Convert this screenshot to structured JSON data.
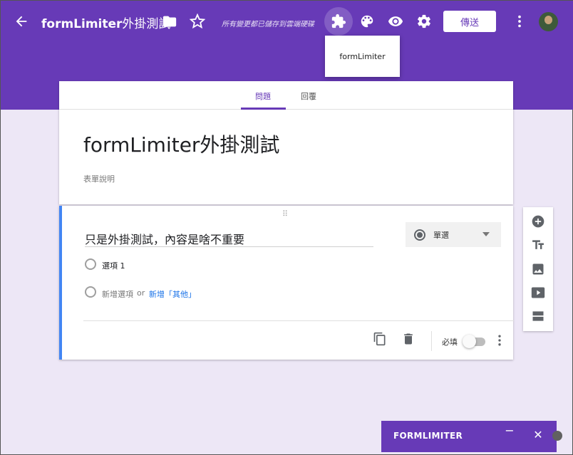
{
  "header": {
    "title_latin": "formLimiter",
    "title_cjk": "外掛測試",
    "saved_note": "所有變更都已儲存到雲端硬碟",
    "send_label": "傳送",
    "icons": [
      "back-arrow-icon",
      "folder-icon",
      "star-icon",
      "addon-puzzle-icon",
      "palette-icon",
      "preview-eye-icon",
      "settings-gear-icon",
      "more-vert-icon",
      "avatar"
    ]
  },
  "addon_menu": {
    "items": [
      "formLimiter"
    ]
  },
  "tabs": [
    {
      "label": "問題",
      "active": true
    },
    {
      "label": "回覆",
      "active": false
    }
  ],
  "form": {
    "title": "formLimiter外掛測試",
    "description_placeholder": "表單說明"
  },
  "question": {
    "drag_handle": "⠿",
    "title": "只是外掛測試，內容是啥不重要",
    "type_label": "單選",
    "options": [
      {
        "label": "選項 1"
      }
    ],
    "add_option_label": "新增選項",
    "or_label": "or",
    "add_other_label": "新增「其他」",
    "required_label": "必填",
    "required_on": false
  },
  "side_toolbar": {
    "icons": [
      "add-question-icon",
      "add-title-icon",
      "add-image-icon",
      "add-video-icon",
      "add-section-icon"
    ]
  },
  "bottom_panel": {
    "title": "FORMLIMITER",
    "minimize": "−",
    "close": "✕"
  },
  "colors": {
    "accent": "#673ab7",
    "background": "#ede7f6",
    "question_highlight": "#4285f4"
  }
}
